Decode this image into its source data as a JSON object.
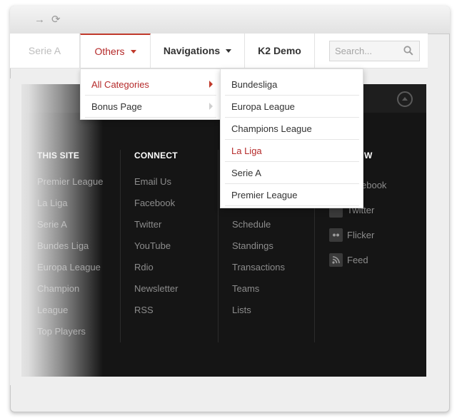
{
  "browser": {
    "forward_glyph": "→",
    "reload_glyph": "⟳"
  },
  "menu": {
    "items": [
      {
        "label": "Serie A"
      },
      {
        "label": "Others"
      },
      {
        "label": "Navigations"
      },
      {
        "label": "K2 Demo"
      }
    ],
    "active": "Others",
    "accent_color": "#c0392b"
  },
  "search": {
    "placeholder": "Search..."
  },
  "dropdown_level1": {
    "items": [
      {
        "label": "All Categories",
        "active": true
      },
      {
        "label": "Bonus Page",
        "active": false
      }
    ]
  },
  "dropdown_level2": {
    "items": [
      {
        "label": "Bundesliga"
      },
      {
        "label": "Europa League"
      },
      {
        "label": "Champions League"
      },
      {
        "label": "La Liga",
        "active": true
      },
      {
        "label": "Serie A"
      },
      {
        "label": "Premier League"
      }
    ]
  },
  "footer": {
    "columns": [
      {
        "heading": "THIS SITE",
        "links": [
          "Premier League",
          "La Liga",
          "Serie A",
          "Bundes Liga",
          "Europa League",
          "Champion",
          "League",
          "Top Players"
        ]
      },
      {
        "heading": "CONNECT",
        "links": [
          "Email Us",
          "Facebook",
          "Twitter",
          "YouTube",
          "Rdio",
          "Newsletter",
          "RSS"
        ]
      },
      {
        "heading": "",
        "links": [
          "Schedule",
          "Standings",
          "Transactions",
          "Teams",
          "Lists"
        ]
      },
      {
        "heading": "W",
        "links": [
          {
            "label": "ebook",
            "icon": "facebook-icon"
          },
          {
            "label": "Twitter",
            "icon": "twitter-icon"
          },
          {
            "label": "Flicker",
            "icon": "flickr-icon"
          },
          {
            "label": "Feed",
            "icon": "rss-icon"
          }
        ]
      }
    ]
  },
  "colors": {
    "panel_bg": "#151515",
    "link_color": "#8c8c8c",
    "heading_color": "#ffffff",
    "active_text": "#b52a2a"
  }
}
